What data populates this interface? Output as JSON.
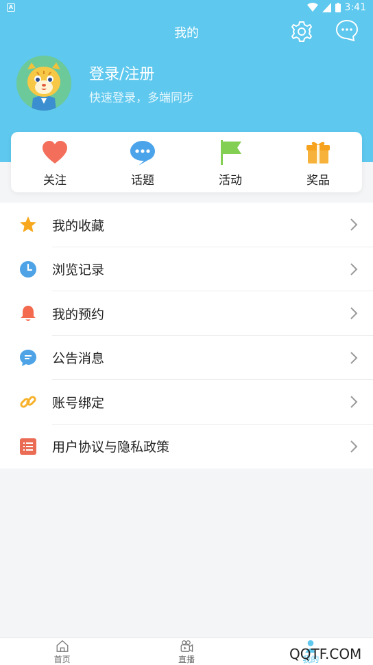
{
  "status_bar": {
    "time": "3:41",
    "left_icon": "A"
  },
  "header": {
    "title": "我的",
    "settings_icon": "gear-icon",
    "message_icon": "chat-bubble-icon"
  },
  "profile": {
    "login_title": "登录/注册",
    "login_subtitle": "快速登录，多端同步"
  },
  "quick_actions": [
    {
      "label": "关注",
      "icon": "heart-icon",
      "color": "#f36f5b"
    },
    {
      "label": "话题",
      "icon": "chat-icon",
      "color": "#4ba3ea"
    },
    {
      "label": "活动",
      "icon": "flag-icon",
      "color": "#82cf54"
    },
    {
      "label": "奖品",
      "icon": "gift-icon",
      "color": "#f7b23b"
    }
  ],
  "menu": [
    {
      "label": "我的收藏",
      "icon": "star-icon",
      "color": "#f7a81f"
    },
    {
      "label": " 浏览记录",
      "icon": "clock-icon",
      "color": "#4da3e6"
    },
    {
      "label": "我的预约",
      "icon": "bell-icon",
      "color": "#f36a4f"
    },
    {
      "label": "公告消息",
      "icon": "message-icon",
      "color": "#4da3e6"
    },
    {
      "label": "账号绑定",
      "icon": "link-icon",
      "color": "#f7b12a"
    },
    {
      "label": "用户协议与隐私政策",
      "icon": "list-icon",
      "color": "#ea6c55"
    }
  ],
  "tabbar": [
    {
      "label": "首页",
      "icon": "home-icon"
    },
    {
      "label": "直播",
      "icon": "live-icon"
    },
    {
      "label": "我的",
      "icon": "user-icon",
      "active": true
    }
  ],
  "watermark": "QQTF.COM",
  "colors": {
    "brand": "#5ec8ee",
    "background": "#f4f5f7"
  }
}
